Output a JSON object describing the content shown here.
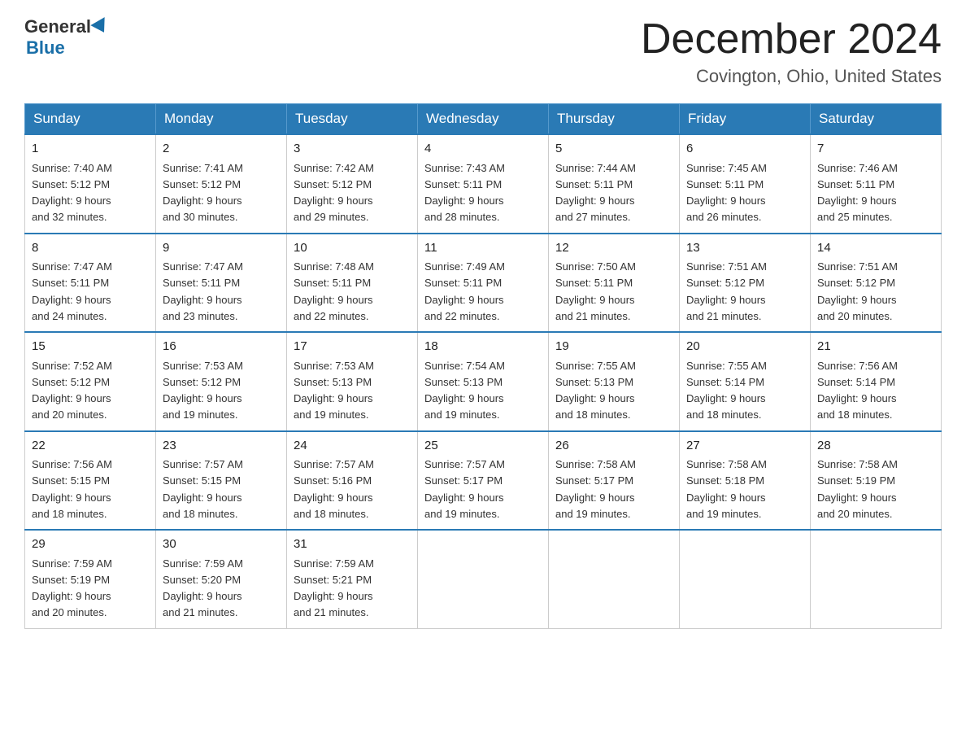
{
  "logo": {
    "general": "General",
    "blue": "Blue"
  },
  "header": {
    "month": "December 2024",
    "location": "Covington, Ohio, United States"
  },
  "weekdays": [
    "Sunday",
    "Monday",
    "Tuesday",
    "Wednesday",
    "Thursday",
    "Friday",
    "Saturday"
  ],
  "weeks": [
    [
      {
        "day": "1",
        "sunrise": "7:40 AM",
        "sunset": "5:12 PM",
        "daylight": "9 hours and 32 minutes."
      },
      {
        "day": "2",
        "sunrise": "7:41 AM",
        "sunset": "5:12 PM",
        "daylight": "9 hours and 30 minutes."
      },
      {
        "day": "3",
        "sunrise": "7:42 AM",
        "sunset": "5:12 PM",
        "daylight": "9 hours and 29 minutes."
      },
      {
        "day": "4",
        "sunrise": "7:43 AM",
        "sunset": "5:11 PM",
        "daylight": "9 hours and 28 minutes."
      },
      {
        "day": "5",
        "sunrise": "7:44 AM",
        "sunset": "5:11 PM",
        "daylight": "9 hours and 27 minutes."
      },
      {
        "day": "6",
        "sunrise": "7:45 AM",
        "sunset": "5:11 PM",
        "daylight": "9 hours and 26 minutes."
      },
      {
        "day": "7",
        "sunrise": "7:46 AM",
        "sunset": "5:11 PM",
        "daylight": "9 hours and 25 minutes."
      }
    ],
    [
      {
        "day": "8",
        "sunrise": "7:47 AM",
        "sunset": "5:11 PM",
        "daylight": "9 hours and 24 minutes."
      },
      {
        "day": "9",
        "sunrise": "7:47 AM",
        "sunset": "5:11 PM",
        "daylight": "9 hours and 23 minutes."
      },
      {
        "day": "10",
        "sunrise": "7:48 AM",
        "sunset": "5:11 PM",
        "daylight": "9 hours and 22 minutes."
      },
      {
        "day": "11",
        "sunrise": "7:49 AM",
        "sunset": "5:11 PM",
        "daylight": "9 hours and 22 minutes."
      },
      {
        "day": "12",
        "sunrise": "7:50 AM",
        "sunset": "5:11 PM",
        "daylight": "9 hours and 21 minutes."
      },
      {
        "day": "13",
        "sunrise": "7:51 AM",
        "sunset": "5:12 PM",
        "daylight": "9 hours and 21 minutes."
      },
      {
        "day": "14",
        "sunrise": "7:51 AM",
        "sunset": "5:12 PM",
        "daylight": "9 hours and 20 minutes."
      }
    ],
    [
      {
        "day": "15",
        "sunrise": "7:52 AM",
        "sunset": "5:12 PM",
        "daylight": "9 hours and 20 minutes."
      },
      {
        "day": "16",
        "sunrise": "7:53 AM",
        "sunset": "5:12 PM",
        "daylight": "9 hours and 19 minutes."
      },
      {
        "day": "17",
        "sunrise": "7:53 AM",
        "sunset": "5:13 PM",
        "daylight": "9 hours and 19 minutes."
      },
      {
        "day": "18",
        "sunrise": "7:54 AM",
        "sunset": "5:13 PM",
        "daylight": "9 hours and 19 minutes."
      },
      {
        "day": "19",
        "sunrise": "7:55 AM",
        "sunset": "5:13 PM",
        "daylight": "9 hours and 18 minutes."
      },
      {
        "day": "20",
        "sunrise": "7:55 AM",
        "sunset": "5:14 PM",
        "daylight": "9 hours and 18 minutes."
      },
      {
        "day": "21",
        "sunrise": "7:56 AM",
        "sunset": "5:14 PM",
        "daylight": "9 hours and 18 minutes."
      }
    ],
    [
      {
        "day": "22",
        "sunrise": "7:56 AM",
        "sunset": "5:15 PM",
        "daylight": "9 hours and 18 minutes."
      },
      {
        "day": "23",
        "sunrise": "7:57 AM",
        "sunset": "5:15 PM",
        "daylight": "9 hours and 18 minutes."
      },
      {
        "day": "24",
        "sunrise": "7:57 AM",
        "sunset": "5:16 PM",
        "daylight": "9 hours and 18 minutes."
      },
      {
        "day": "25",
        "sunrise": "7:57 AM",
        "sunset": "5:17 PM",
        "daylight": "9 hours and 19 minutes."
      },
      {
        "day": "26",
        "sunrise": "7:58 AM",
        "sunset": "5:17 PM",
        "daylight": "9 hours and 19 minutes."
      },
      {
        "day": "27",
        "sunrise": "7:58 AM",
        "sunset": "5:18 PM",
        "daylight": "9 hours and 19 minutes."
      },
      {
        "day": "28",
        "sunrise": "7:58 AM",
        "sunset": "5:19 PM",
        "daylight": "9 hours and 20 minutes."
      }
    ],
    [
      {
        "day": "29",
        "sunrise": "7:59 AM",
        "sunset": "5:19 PM",
        "daylight": "9 hours and 20 minutes."
      },
      {
        "day": "30",
        "sunrise": "7:59 AM",
        "sunset": "5:20 PM",
        "daylight": "9 hours and 21 minutes."
      },
      {
        "day": "31",
        "sunrise": "7:59 AM",
        "sunset": "5:21 PM",
        "daylight": "9 hours and 21 minutes."
      },
      null,
      null,
      null,
      null
    ]
  ],
  "labels": {
    "sunrise": "Sunrise: ",
    "sunset": "Sunset: ",
    "daylight": "Daylight: "
  }
}
